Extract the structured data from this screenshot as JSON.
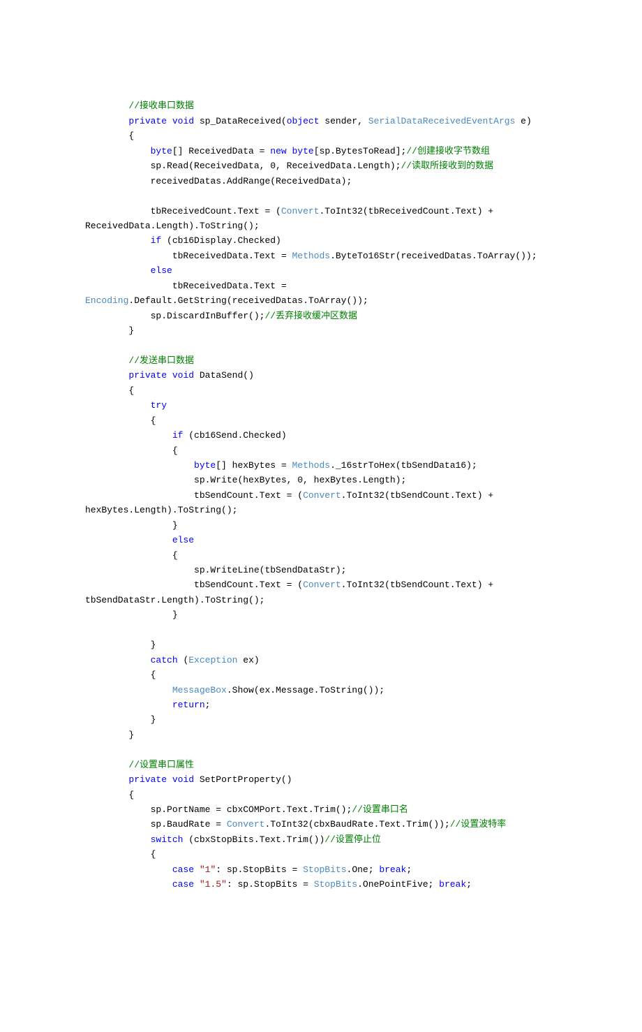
{
  "lines": [
    {
      "indent": 2,
      "spans": [
        {
          "cls": "",
          "t": ""
        }
      ]
    },
    {
      "indent": 2,
      "spans": [
        {
          "cls": "cmt",
          "t": "//接收串口数据"
        }
      ]
    },
    {
      "indent": 2,
      "spans": [
        {
          "cls": "kw",
          "t": "private"
        },
        {
          "cls": "",
          "t": " "
        },
        {
          "cls": "kw",
          "t": "void"
        },
        {
          "cls": "",
          "t": " sp_DataReceived("
        },
        {
          "cls": "kw",
          "t": "object"
        },
        {
          "cls": "",
          "t": " sender, "
        },
        {
          "cls": "type",
          "t": "SerialDataReceivedEventArgs"
        },
        {
          "cls": "",
          "t": " e)"
        }
      ]
    },
    {
      "indent": 2,
      "spans": [
        {
          "cls": "",
          "t": "{"
        }
      ]
    },
    {
      "indent": 3,
      "spans": [
        {
          "cls": "kw",
          "t": "byte"
        },
        {
          "cls": "",
          "t": "[] ReceivedData = "
        },
        {
          "cls": "kw",
          "t": "new"
        },
        {
          "cls": "",
          "t": " "
        },
        {
          "cls": "kw",
          "t": "byte"
        },
        {
          "cls": "",
          "t": "[sp.BytesToRead];"
        },
        {
          "cls": "cmt",
          "t": "//创建接收字节数组"
        }
      ]
    },
    {
      "indent": 3,
      "spans": [
        {
          "cls": "",
          "t": "sp.Read(ReceivedData, 0, ReceivedData.Length);"
        },
        {
          "cls": "cmt",
          "t": "//读取所接收到的数据"
        }
      ]
    },
    {
      "indent": 3,
      "spans": [
        {
          "cls": "",
          "t": "receivedDatas.AddRange(ReceivedData);"
        }
      ]
    },
    {
      "indent": 3,
      "spans": [
        {
          "cls": "",
          "t": ""
        }
      ]
    },
    {
      "indent": 3,
      "spans": [
        {
          "cls": "",
          "t": "tbReceivedCount.Text = ("
        },
        {
          "cls": "type",
          "t": "Convert"
        },
        {
          "cls": "",
          "t": ".ToInt32(tbReceivedCount.Text) + "
        }
      ]
    },
    {
      "indent": 0,
      "spans": [
        {
          "cls": "",
          "t": "ReceivedData.Length).ToString();"
        }
      ]
    },
    {
      "indent": 3,
      "spans": [
        {
          "cls": "kw",
          "t": "if"
        },
        {
          "cls": "",
          "t": " (cb16Display.Checked)"
        }
      ]
    },
    {
      "indent": 4,
      "spans": [
        {
          "cls": "",
          "t": "tbReceivedData.Text = "
        },
        {
          "cls": "type",
          "t": "Methods"
        },
        {
          "cls": "",
          "t": ".ByteTo16Str(receivedDatas.ToArray());"
        }
      ]
    },
    {
      "indent": 3,
      "spans": [
        {
          "cls": "kw",
          "t": "else"
        }
      ]
    },
    {
      "indent": 4,
      "spans": [
        {
          "cls": "",
          "t": "tbReceivedData.Text = "
        }
      ]
    },
    {
      "indent": 0,
      "spans": [
        {
          "cls": "type",
          "t": "Encoding"
        },
        {
          "cls": "",
          "t": ".Default.GetString(receivedDatas.ToArray());"
        }
      ]
    },
    {
      "indent": 3,
      "spans": [
        {
          "cls": "",
          "t": "sp.DiscardInBuffer();"
        },
        {
          "cls": "cmt",
          "t": "//丢弃接收缓冲区数据"
        }
      ]
    },
    {
      "indent": 2,
      "spans": [
        {
          "cls": "",
          "t": "}"
        }
      ]
    },
    {
      "indent": 2,
      "spans": [
        {
          "cls": "",
          "t": ""
        }
      ]
    },
    {
      "indent": 2,
      "spans": [
        {
          "cls": "cmt",
          "t": "//发送串口数据"
        }
      ]
    },
    {
      "indent": 2,
      "spans": [
        {
          "cls": "kw",
          "t": "private"
        },
        {
          "cls": "",
          "t": " "
        },
        {
          "cls": "kw",
          "t": "void"
        },
        {
          "cls": "",
          "t": " DataSend()"
        }
      ]
    },
    {
      "indent": 2,
      "spans": [
        {
          "cls": "",
          "t": "{"
        }
      ]
    },
    {
      "indent": 3,
      "spans": [
        {
          "cls": "kw",
          "t": "try"
        }
      ]
    },
    {
      "indent": 3,
      "spans": [
        {
          "cls": "",
          "t": "{"
        }
      ]
    },
    {
      "indent": 4,
      "spans": [
        {
          "cls": "kw",
          "t": "if"
        },
        {
          "cls": "",
          "t": " (cb16Send.Checked)"
        }
      ]
    },
    {
      "indent": 4,
      "spans": [
        {
          "cls": "",
          "t": "{"
        }
      ]
    },
    {
      "indent": 5,
      "spans": [
        {
          "cls": "kw",
          "t": "byte"
        },
        {
          "cls": "",
          "t": "[] hexBytes = "
        },
        {
          "cls": "type",
          "t": "Methods"
        },
        {
          "cls": "",
          "t": "._16strToHex(tbSendData16);"
        }
      ]
    },
    {
      "indent": 5,
      "spans": [
        {
          "cls": "",
          "t": "sp.Write(hexBytes, 0, hexBytes.Length);"
        }
      ]
    },
    {
      "indent": 5,
      "spans": [
        {
          "cls": "",
          "t": "tbSendCount.Text = ("
        },
        {
          "cls": "type",
          "t": "Convert"
        },
        {
          "cls": "",
          "t": ".ToInt32(tbSendCount.Text) + "
        }
      ]
    },
    {
      "indent": 0,
      "spans": [
        {
          "cls": "",
          "t": "hexBytes.Length).ToString();"
        }
      ]
    },
    {
      "indent": 4,
      "spans": [
        {
          "cls": "",
          "t": "}"
        }
      ]
    },
    {
      "indent": 4,
      "spans": [
        {
          "cls": "kw",
          "t": "else"
        }
      ]
    },
    {
      "indent": 4,
      "spans": [
        {
          "cls": "",
          "t": "{"
        }
      ]
    },
    {
      "indent": 5,
      "spans": [
        {
          "cls": "",
          "t": "sp.WriteLine(tbSendDataStr);"
        }
      ]
    },
    {
      "indent": 5,
      "spans": [
        {
          "cls": "",
          "t": "tbSendCount.Text = ("
        },
        {
          "cls": "type",
          "t": "Convert"
        },
        {
          "cls": "",
          "t": ".ToInt32(tbSendCount.Text) + "
        }
      ]
    },
    {
      "indent": 0,
      "spans": [
        {
          "cls": "",
          "t": "tbSendDataStr.Length).ToString();"
        }
      ]
    },
    {
      "indent": 4,
      "spans": [
        {
          "cls": "",
          "t": "}"
        }
      ]
    },
    {
      "indent": 4,
      "spans": [
        {
          "cls": "",
          "t": ""
        }
      ]
    },
    {
      "indent": 3,
      "spans": [
        {
          "cls": "",
          "t": "}"
        }
      ]
    },
    {
      "indent": 3,
      "spans": [
        {
          "cls": "kw",
          "t": "catch"
        },
        {
          "cls": "",
          "t": " ("
        },
        {
          "cls": "type",
          "t": "Exception"
        },
        {
          "cls": "",
          "t": " ex)"
        }
      ]
    },
    {
      "indent": 3,
      "spans": [
        {
          "cls": "",
          "t": "{"
        }
      ]
    },
    {
      "indent": 4,
      "spans": [
        {
          "cls": "type",
          "t": "MessageBox"
        },
        {
          "cls": "",
          "t": ".Show(ex.Message.ToString());"
        }
      ]
    },
    {
      "indent": 4,
      "spans": [
        {
          "cls": "kw",
          "t": "return"
        },
        {
          "cls": "",
          "t": ";"
        }
      ]
    },
    {
      "indent": 3,
      "spans": [
        {
          "cls": "",
          "t": "}"
        }
      ]
    },
    {
      "indent": 2,
      "spans": [
        {
          "cls": "",
          "t": "}"
        }
      ]
    },
    {
      "indent": 2,
      "spans": [
        {
          "cls": "",
          "t": ""
        }
      ]
    },
    {
      "indent": 2,
      "spans": [
        {
          "cls": "cmt",
          "t": "//设置串口属性"
        }
      ]
    },
    {
      "indent": 2,
      "spans": [
        {
          "cls": "kw",
          "t": "private"
        },
        {
          "cls": "",
          "t": " "
        },
        {
          "cls": "kw",
          "t": "void"
        },
        {
          "cls": "",
          "t": " SetPortProperty()"
        }
      ]
    },
    {
      "indent": 2,
      "spans": [
        {
          "cls": "",
          "t": "{"
        }
      ]
    },
    {
      "indent": 3,
      "spans": [
        {
          "cls": "",
          "t": "sp.PortName = cbxCOMPort.Text.Trim();"
        },
        {
          "cls": "cmt",
          "t": "//设置串口名"
        }
      ]
    },
    {
      "indent": 3,
      "spans": [
        {
          "cls": "",
          "t": "sp.BaudRate = "
        },
        {
          "cls": "type",
          "t": "Convert"
        },
        {
          "cls": "",
          "t": ".ToInt32(cbxBaudRate.Text.Trim());"
        },
        {
          "cls": "cmt",
          "t": "//设置波特率"
        }
      ]
    },
    {
      "indent": 3,
      "spans": [
        {
          "cls": "kw",
          "t": "switch"
        },
        {
          "cls": "",
          "t": " (cbxStopBits.Text.Trim())"
        },
        {
          "cls": "cmt",
          "t": "//设置停止位"
        }
      ]
    },
    {
      "indent": 3,
      "spans": [
        {
          "cls": "",
          "t": "{"
        }
      ]
    },
    {
      "indent": 4,
      "spans": [
        {
          "cls": "kw",
          "t": "case"
        },
        {
          "cls": "",
          "t": " "
        },
        {
          "cls": "str",
          "t": "\"1\""
        },
        {
          "cls": "",
          "t": ": sp.StopBits = "
        },
        {
          "cls": "type",
          "t": "StopBits"
        },
        {
          "cls": "",
          "t": ".One; "
        },
        {
          "cls": "kw",
          "t": "break"
        },
        {
          "cls": "",
          "t": ";"
        }
      ]
    },
    {
      "indent": 4,
      "spans": [
        {
          "cls": "kw",
          "t": "case"
        },
        {
          "cls": "",
          "t": " "
        },
        {
          "cls": "str",
          "t": "\"1.5\""
        },
        {
          "cls": "",
          "t": ": sp.StopBits = "
        },
        {
          "cls": "type",
          "t": "StopBits"
        },
        {
          "cls": "",
          "t": ".OnePointFive; "
        },
        {
          "cls": "kw",
          "t": "break"
        },
        {
          "cls": "",
          "t": ";"
        }
      ]
    }
  ],
  "indentUnit": "    "
}
